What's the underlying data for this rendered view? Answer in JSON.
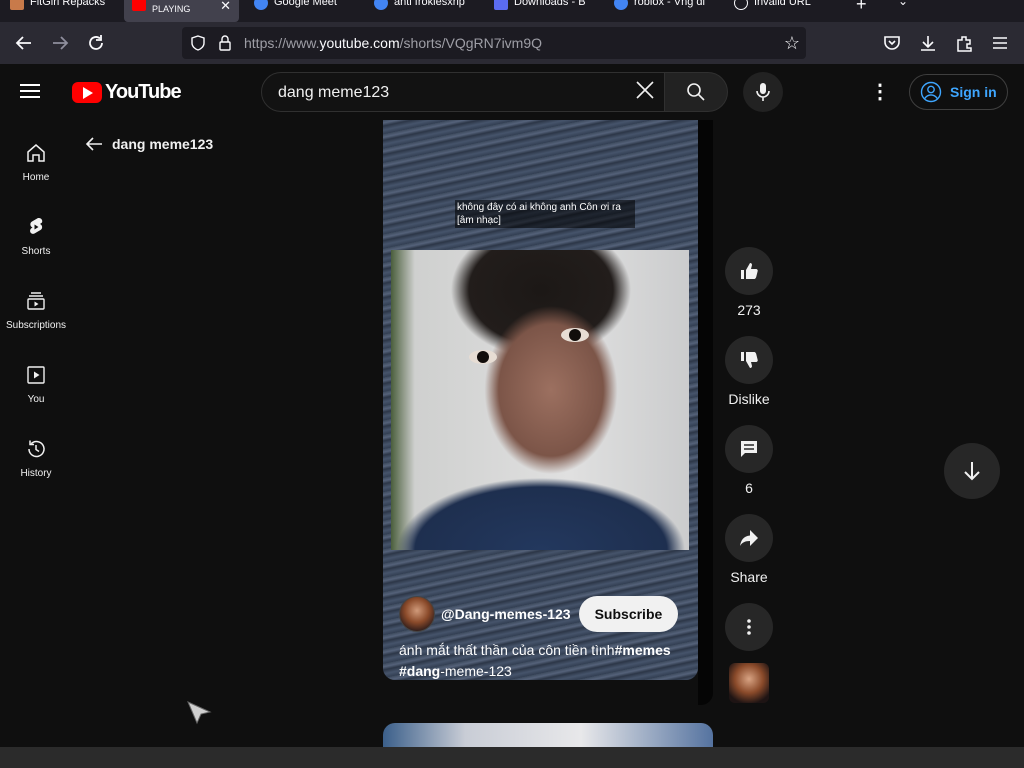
{
  "browser": {
    "tabs": [
      {
        "title": "FitGirl Repacks",
        "active": false
      },
      {
        "title": "PLAYING",
        "active": true
      },
      {
        "title": "Google Meet",
        "active": false
      },
      {
        "title": "anti frokiesxrip",
        "active": false
      },
      {
        "title": "Downloads - B",
        "active": false
      },
      {
        "title": "roblox - Vng di",
        "active": false
      },
      {
        "title": "Invalid URL",
        "active": false
      }
    ],
    "url_prefix": "https://www.",
    "url_host": "youtube.com",
    "url_path": "/shorts/VQgRN7ivm9Q"
  },
  "header": {
    "logo_text": "YouTube",
    "search_query": "dang meme123",
    "sign_in": "Sign in"
  },
  "guide": {
    "items": [
      {
        "label": "Home",
        "icon": "home-icon"
      },
      {
        "label": "Shorts",
        "icon": "shorts-icon"
      },
      {
        "label": "Subscriptions",
        "icon": "subscriptions-icon"
      },
      {
        "label": "You",
        "icon": "you-icon"
      },
      {
        "label": "History",
        "icon": "history-icon"
      }
    ]
  },
  "results": {
    "back_label": "dang meme123"
  },
  "short": {
    "caption": "không đây có ai không anh Côn ơi ra [âm nhạc]",
    "channel": "@Dang-memes-123",
    "subscribe": "Subscribe",
    "title_plain": "ánh mắt thất thần của côn tiền tình",
    "title_tag1": "#memes",
    "title_tag2": "#dang",
    "title_tail": "-meme-123"
  },
  "actions": {
    "likes": "273",
    "dislike": "Dislike",
    "comments": "6",
    "share": "Share"
  },
  "colors": {
    "accent": "#3ea6ff",
    "brand": "#ff0000",
    "background": "#0f0f0f"
  }
}
